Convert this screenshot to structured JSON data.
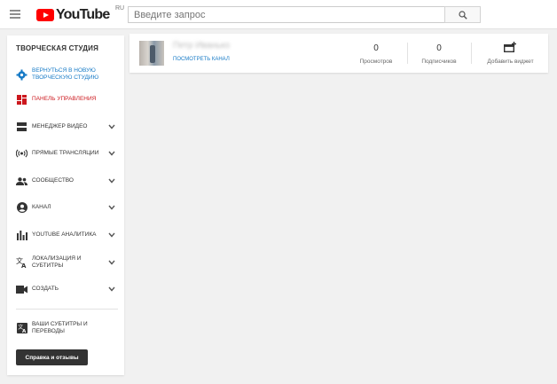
{
  "header": {
    "logo_text": "YouTube",
    "logo_region": "RU",
    "search_placeholder": "Введите запрос"
  },
  "sidebar": {
    "title": "ТВОРЧЕСКАЯ СТУДИЯ",
    "items": [
      {
        "label": "ВЕРНУТЬСЯ В НОВУЮ ТВОРЧЕСКУЮ СТУДИЮ",
        "icon": "gear-icon"
      },
      {
        "label": "ПАНЕЛЬ УПРАВЛЕНИЯ",
        "icon": "dashboard-icon"
      },
      {
        "label": "МЕНЕДЖЕР ВИДЕО",
        "icon": "video-manager-icon"
      },
      {
        "label": "ПРЯМЫЕ ТРАНСЛЯЦИИ",
        "icon": "live-icon"
      },
      {
        "label": "СООБЩЕСТВО",
        "icon": "community-icon"
      },
      {
        "label": "КАНАЛ",
        "icon": "channel-icon"
      },
      {
        "label": "YOUTUBE АНАЛИТИКА",
        "icon": "analytics-icon"
      },
      {
        "label": "ЛОКАЛИЗАЦИЯ И СУБТИТРЫ",
        "icon": "translate-icon"
      },
      {
        "label": "СОЗДАТЬ",
        "icon": "create-video-icon"
      },
      {
        "label": "ВАШИ СУБТИТРЫ И ПЕРЕВОДЫ",
        "icon": "subtitles-icon"
      }
    ],
    "help_button": "Справка и отзывы"
  },
  "channel": {
    "name": "Петр Иванько",
    "view_link": "ПОСМОТРЕТЬ КАНАЛ",
    "stats": [
      {
        "value": "0",
        "label": "Просмотров"
      },
      {
        "value": "0",
        "label": "Подписчиков"
      }
    ],
    "add_widget": "Добавить виджет"
  },
  "colors": {
    "brand_red": "#ff0000",
    "link_blue": "#167ac6",
    "active_red": "#cc181e"
  }
}
